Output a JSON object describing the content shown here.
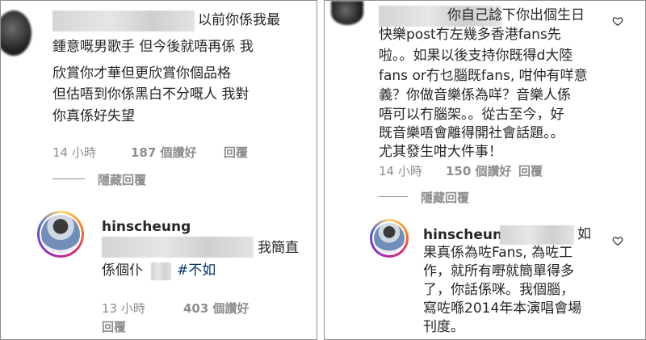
{
  "left": {
    "comment": {
      "lines": [
        "以前你係我最",
        "鍾意嘅男歌手 但今後就唔再係 我",
        "欣賞你才華但更欣賞你個品格",
        "但估唔到你係黑白不分嘅人 我對",
        "你真係好失望"
      ],
      "time": "14 小時",
      "likes": "187 個讚好",
      "reply": "回覆"
    },
    "hide_replies": "隱藏回覆",
    "reply": {
      "username": "hinscheung",
      "line1": "我簡直",
      "line2_pre": "係個仆",
      "hashtag": "#不如",
      "time": "13 小時",
      "likes": "403 個讚好",
      "reply": "回覆"
    }
  },
  "right": {
    "comment": {
      "lines": [
        "你自己諗下你出個生日",
        "快樂post冇左幾多香港fans先",
        "啦。。如果以後支持你既得d大陸",
        "fans or冇乜腦既fans, 咁仲有咩意",
        "義？你做音樂係為咩？音樂人係",
        "唔可以冇腦架。。從古至今，好",
        "既音樂唔會離得開社會話題。。",
        "尤其發生咁大件事！"
      ],
      "time": "14 小時",
      "likes": "150 個讚好",
      "reply": "回覆"
    },
    "hide_replies": "隱藏回覆",
    "reply": {
      "username": "hinscheung",
      "lines": [
        "如",
        "果真係為咗Fans, 為咗工",
        "作，就所有嘢就簡單得多",
        "了，你話係咪。我個腦，",
        "寫咗喺2014年本演唱會場",
        "刊度。"
      ]
    }
  },
  "icons": [
    "heart-icon"
  ],
  "colors": {
    "meta": "#8e8e8e",
    "text": "#262626",
    "hashtag": "#00376b"
  }
}
